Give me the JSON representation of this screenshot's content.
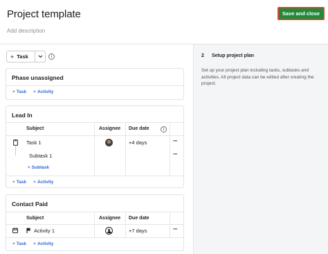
{
  "header": {
    "title": "Project template",
    "description_placeholder": "Add description",
    "save_label": "Save and close"
  },
  "toolbar": {
    "task_button_label": "Task"
  },
  "sections": [
    {
      "title": "Phase unassigned",
      "add_task": "Task",
      "add_activity": "Activity"
    },
    {
      "title": "Lead In",
      "columns": [
        "Subject",
        "Assignee",
        "Due date"
      ],
      "rows": [
        {
          "subject": "Task 1",
          "due": "+4 days"
        },
        {
          "subject": "Subtask 1"
        }
      ],
      "add_subtask": "Subtask",
      "add_task": "Task",
      "add_activity": "Activity"
    },
    {
      "title": "Contact Paid",
      "columns": [
        "Subject",
        "Assignee",
        "Due date"
      ],
      "rows": [
        {
          "subject": "Activity 1",
          "due": "+7 days"
        }
      ],
      "add_task": "Task",
      "add_activity": "Activity"
    }
  ],
  "side_panel": {
    "step_number": "2",
    "step_title": "Setup project plan",
    "step_text": "Set up your project plan including tasks, subtasks and activities. All project data can be edited after creating the project."
  },
  "colors": {
    "primary_green": "#1f8a3a",
    "link_blue": "#3166d4",
    "panel_bg": "#f4f5f6"
  }
}
